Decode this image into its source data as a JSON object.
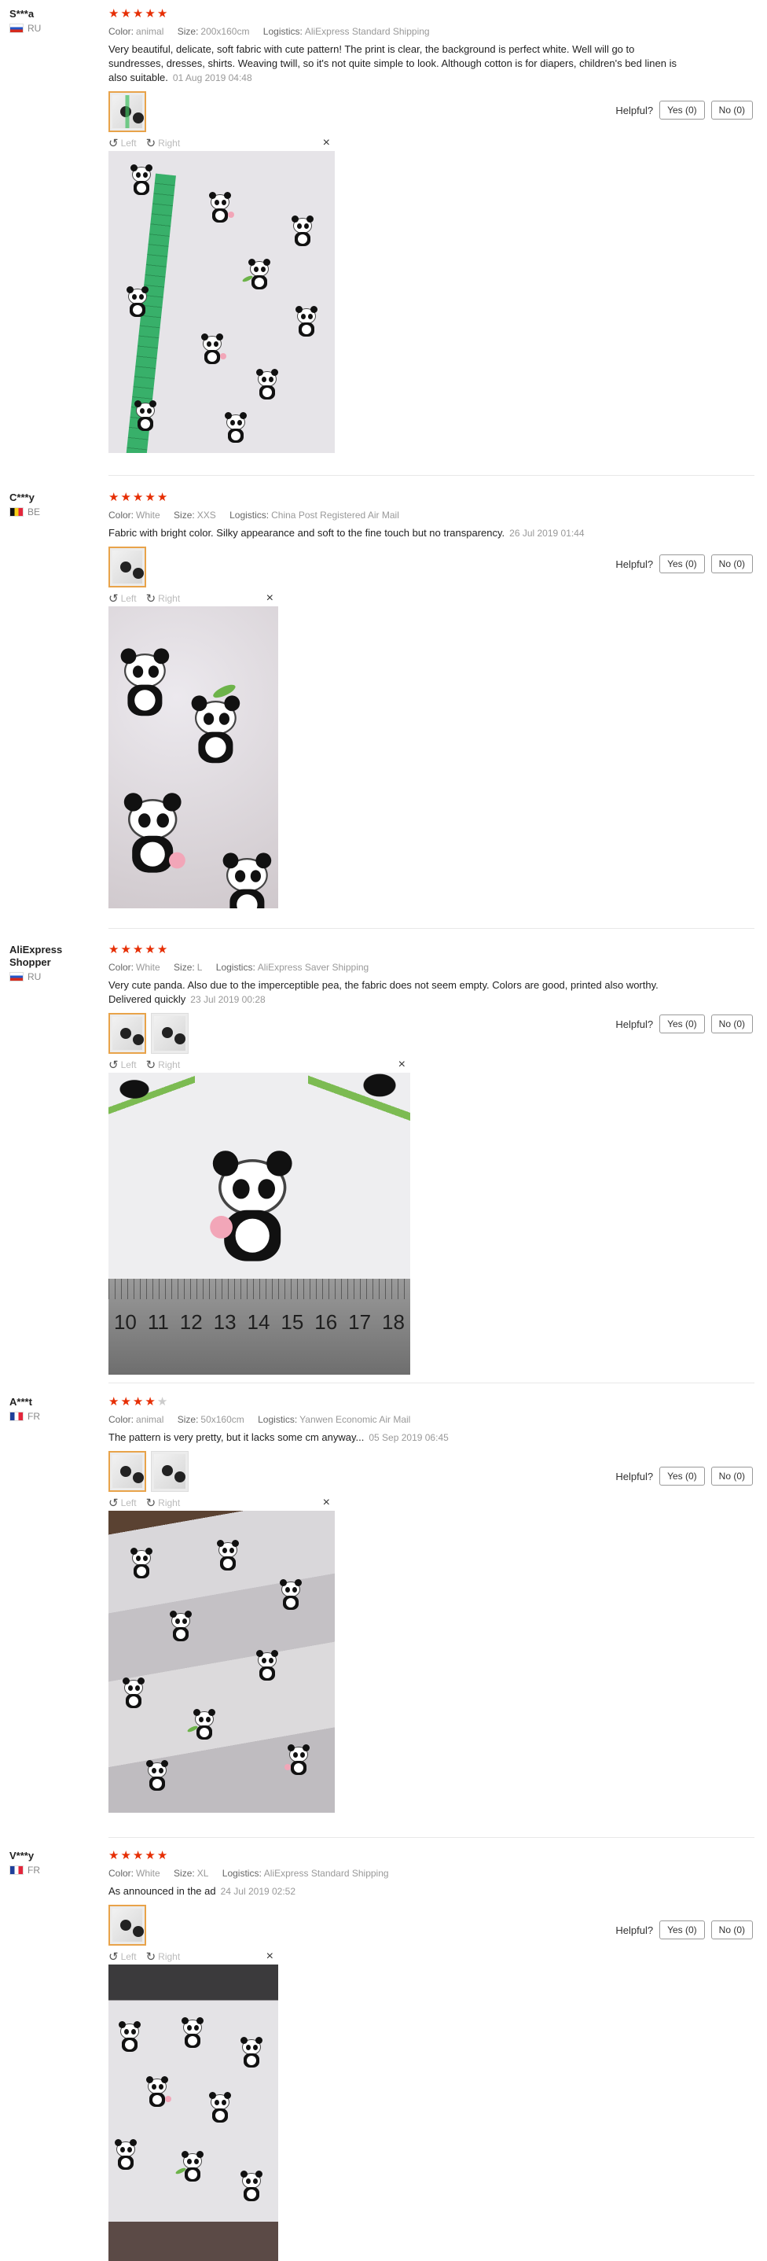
{
  "labels": {
    "color": "Color:",
    "size": "Size:",
    "logistics": "Logistics:",
    "helpful": "Helpful?",
    "left": "Left",
    "right": "Right",
    "close": "×"
  },
  "colors": {
    "star": "#e62e04",
    "active_thumb_border": "#e8a34a"
  },
  "icons": {
    "rotate_left": "rotate-left-icon",
    "rotate_right": "rotate-right-icon",
    "close": "close-icon",
    "flag": "flag-icon",
    "star": "star-icon"
  },
  "reviews": [
    {
      "user": "S***a",
      "country": "RU",
      "rating": 5,
      "color": "animal",
      "size": "200x160cm",
      "logistics": "AliExpress Standard Shipping",
      "text": "Very beautiful, delicate, soft fabric with cute pattern! The print is clear, the background is perfect white. Well will go to sundresses, dresses, shirts. Weaving twill, so it's not quite simple to look. Although cotton is for diapers, children's bed linen is also suitable.",
      "date": "01 Aug 2019 04:48",
      "yes": "Yes (0)",
      "no": "No (0)"
    },
    {
      "user": "C***y",
      "country": "BE",
      "rating": 5,
      "color": "White",
      "size": "XXS",
      "logistics": "China Post Registered Air Mail",
      "text": "Fabric with bright color. Silky appearance and soft to the fine touch but no transparency.",
      "date": "26 Jul 2019 01:44",
      "yes": "Yes (0)",
      "no": "No (0)"
    },
    {
      "user": "AliExpress Shopper",
      "country": "RU",
      "rating": 5,
      "color": "White",
      "size": "L",
      "logistics": "AliExpress Saver Shipping",
      "text": "Very cute panda. Also due to the imperceptible pea, the fabric does not seem empty. Colors are good, printed also worthy. Delivered quickly",
      "date": "23 Jul 2019 00:28",
      "yes": "Yes (0)",
      "no": "No (0)",
      "ruler": [
        "10",
        "11",
        "12",
        "13",
        "14",
        "15",
        "16",
        "17",
        "18"
      ]
    },
    {
      "user": "A***t",
      "country": "FR",
      "rating": 4,
      "color": "animal",
      "size": "50x160cm",
      "logistics": "Yanwen Economic Air Mail",
      "text": "The pattern is very pretty, but it lacks some cm anyway...",
      "date": "05 Sep 2019 06:45",
      "yes": "Yes (0)",
      "no": "No (0)"
    },
    {
      "user": "V***y",
      "country": "FR",
      "rating": 5,
      "color": "White",
      "size": "XL",
      "logistics": "AliExpress Standard Shipping",
      "text": "As announced in the ad",
      "date": "24 Jul 2019 02:52",
      "yes": "Yes (0)",
      "no": "No (0)"
    }
  ]
}
